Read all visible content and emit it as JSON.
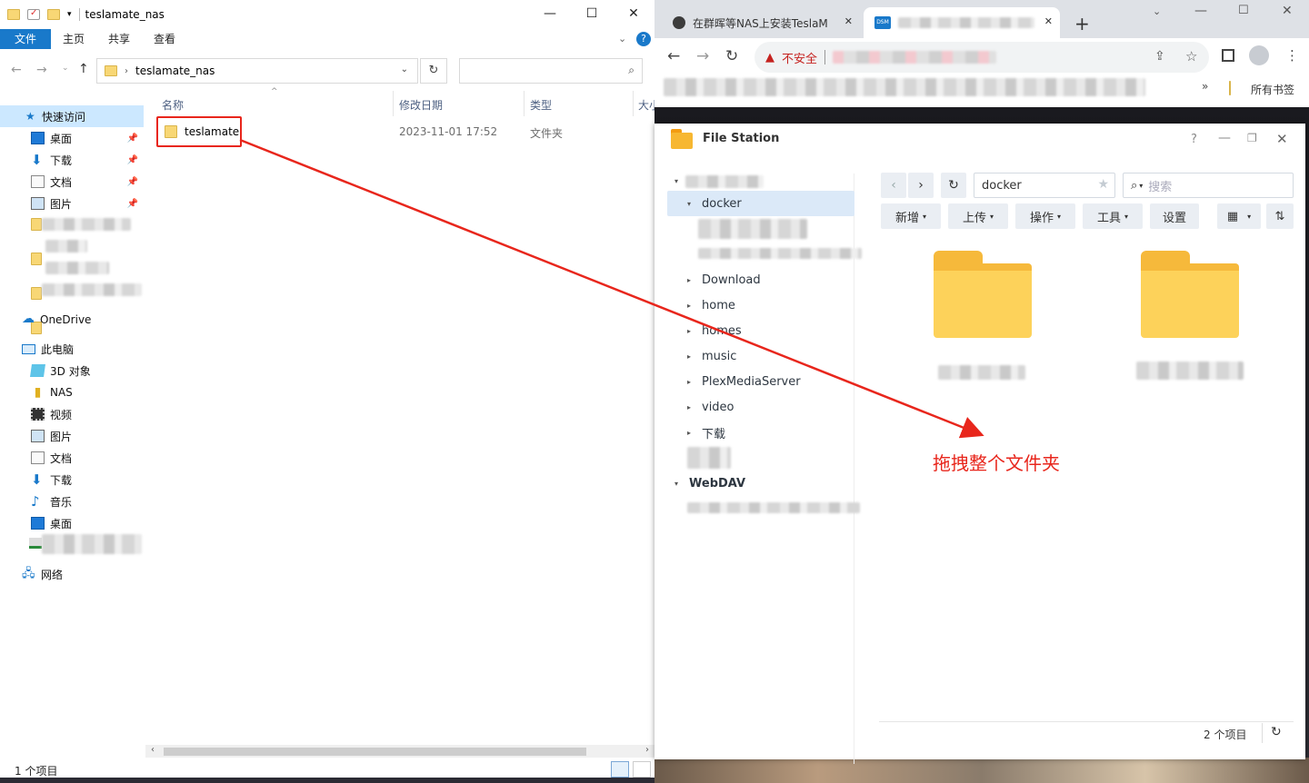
{
  "explorer": {
    "title": "teslamate_nas",
    "ribbon_tabs": [
      "文件",
      "主页",
      "共享",
      "查看"
    ],
    "address": "teslamate_nas",
    "columns": {
      "name": "名称",
      "modified": "修改日期",
      "type": "类型",
      "size": "大小"
    },
    "file": {
      "name": "teslamate",
      "modified": "2023-11-01 17:52",
      "type": "文件夹"
    },
    "quick_access": {
      "label": "快速访问",
      "items": [
        "桌面",
        "下载",
        "文档",
        "图片"
      ]
    },
    "onedrive": "OneDrive",
    "this_pc": {
      "label": "此电脑",
      "items": [
        "3D 对象",
        "NAS",
        "视频",
        "图片",
        "文档",
        "下载",
        "音乐",
        "桌面"
      ]
    },
    "network": "网络",
    "status": "1 个项目"
  },
  "chrome": {
    "tab1": "在群晖等NAS上安装TeslaM",
    "tab2_badge": "DSM",
    "insecure": "不安全",
    "bookmarks_all": "所有书签"
  },
  "filestation": {
    "title": "File Station",
    "tree": [
      "docker",
      "Download",
      "home",
      "homes",
      "music",
      "PlexMediaServer",
      "video",
      "下载"
    ],
    "webdav": "WebDAV",
    "path": "docker",
    "search_placeholder": "搜索",
    "buttons": [
      "新增",
      "上传",
      "操作",
      "工具",
      "设置"
    ],
    "status": "2 个项目"
  },
  "annotation": "拖拽整个文件夹",
  "colors": {
    "accent": "#1979ca",
    "annotation": "#e8261c",
    "folder": "#fdd25a"
  }
}
